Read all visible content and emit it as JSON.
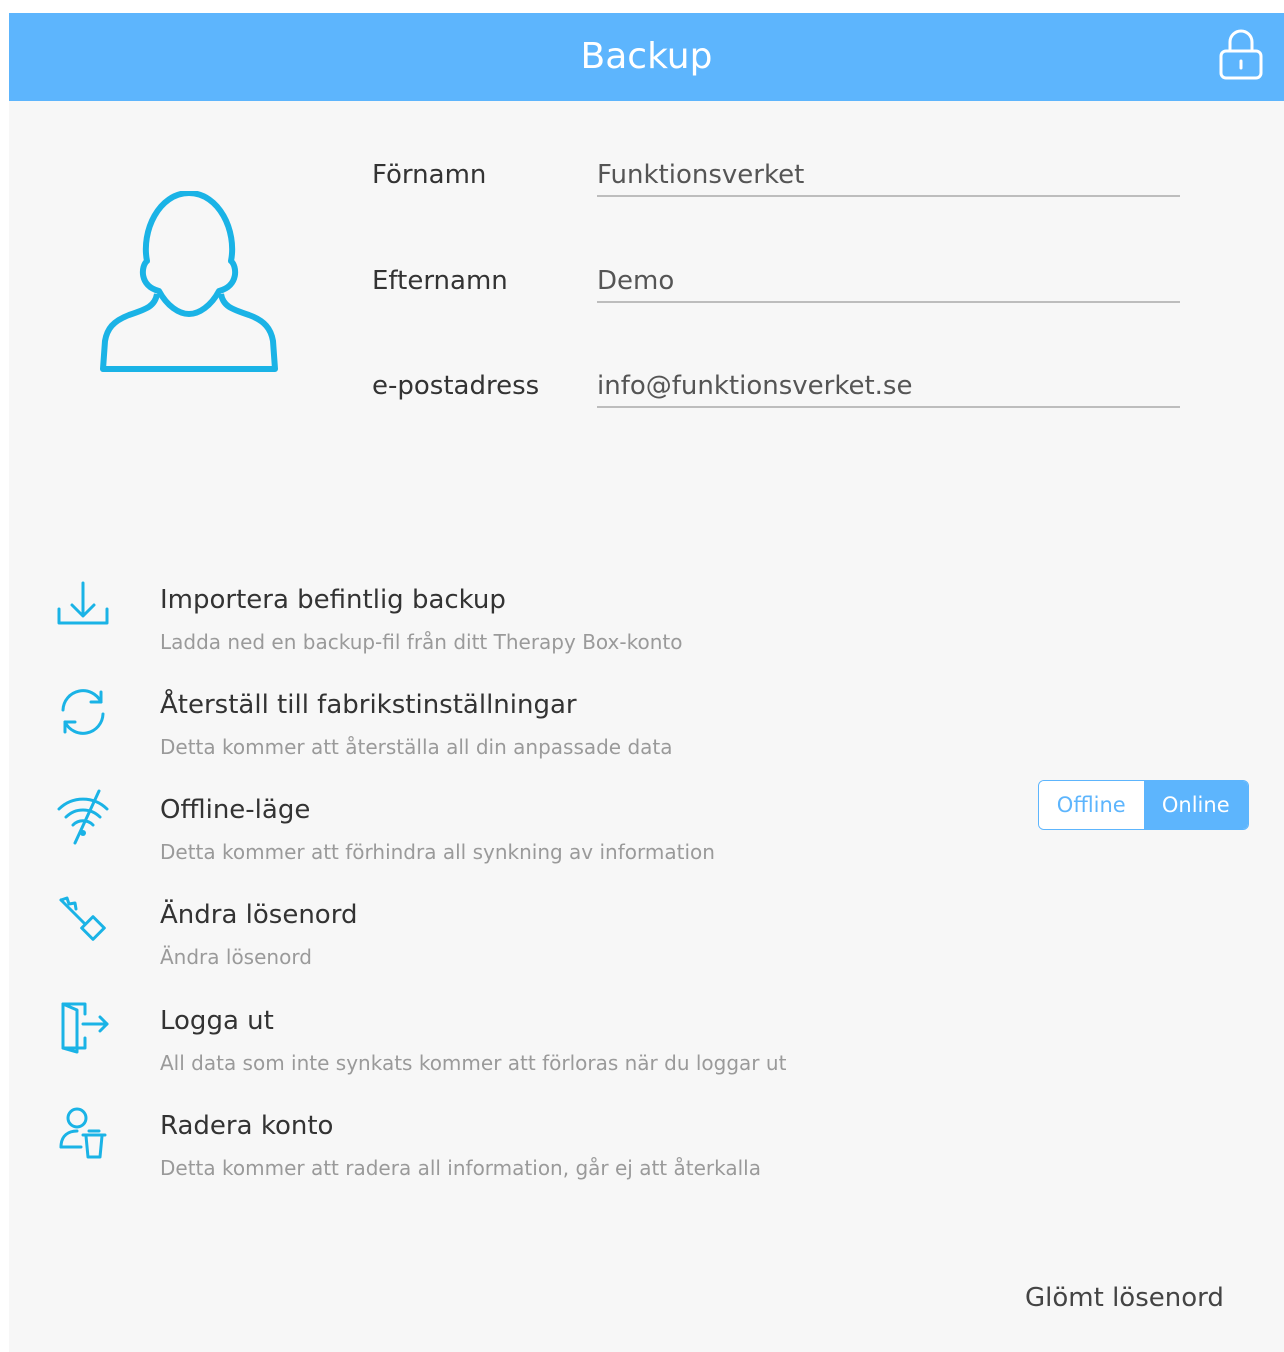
{
  "header": {
    "title": "Backup",
    "lock_icon": "lock-icon"
  },
  "colors": {
    "accent": "#5db5fd",
    "text": "#333333",
    "subtext": "#9a9a9a"
  },
  "profile": {
    "avatar_icon": "user-avatar-icon",
    "fields": {
      "first_name": {
        "label": "Förnamn",
        "value": "Funktionsverket"
      },
      "last_name": {
        "label": "Efternamn",
        "value": "Demo"
      },
      "email": {
        "label": "e-postadress",
        "value": "info@funktionsverket.se"
      }
    }
  },
  "actions": [
    {
      "icon": "download-icon",
      "title": "Importera befintlig backup",
      "subtitle": "Ladda ned en backup-fil från ditt Therapy Box-konto"
    },
    {
      "icon": "refresh-icon",
      "title": "Återställ till fabrikstinställningar",
      "subtitle": "Detta kommer att återställa all din anpassade data"
    },
    {
      "icon": "wifi-off-icon",
      "title": "Offline-läge",
      "subtitle": "Detta kommer att förhindra all synkning av information"
    },
    {
      "icon": "key-icon",
      "title": "Ändra lösenord",
      "subtitle": "Ändra lösenord"
    },
    {
      "icon": "logout-icon",
      "title": "Logga ut",
      "subtitle": "All data som inte synkats kommer att förloras när du loggar ut"
    },
    {
      "icon": "delete-user-icon",
      "title": "Radera konto",
      "subtitle": "Detta kommer att radera all information, går ej att återkalla"
    }
  ],
  "mode_toggle": {
    "options": [
      "Offline",
      "Online"
    ],
    "selected": "Online"
  },
  "forgot_password": "Glömt lösenord"
}
